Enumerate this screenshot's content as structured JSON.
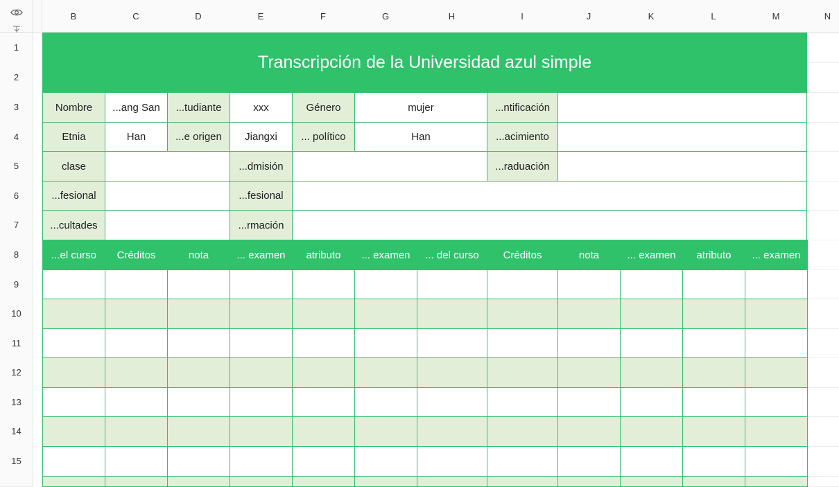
{
  "columns": [
    "B",
    "C",
    "D",
    "E",
    "F",
    "G",
    "H",
    "I",
    "J",
    "K",
    "L",
    "M",
    "N"
  ],
  "rows": [
    "1",
    "2",
    "3",
    "4",
    "5",
    "6",
    "7",
    "8",
    "9",
    "10",
    "11",
    "12",
    "13",
    "14",
    "15",
    ""
  ],
  "title": "Transcripción de la Universidad azul simple",
  "info": {
    "r3": {
      "b": "Nombre",
      "c": "...ang San",
      "d": "...tudiante",
      "e": "xxx",
      "f": "Género",
      "gh": "mujer",
      "i": "...ntificación",
      "jm": ""
    },
    "r4": {
      "b": "Etnia",
      "c": "Han",
      "d": "...e origen",
      "e": "Jiangxi",
      "f": "... político",
      "gh": "Han",
      "i": "...acimiento",
      "jm": ""
    },
    "r5": {
      "b": "clase",
      "cd": "",
      "e": "...dmisión",
      "fh": "",
      "i": "...raduación",
      "jm": ""
    },
    "r6": {
      "b": "...fesional",
      "cd": "",
      "e": "...fesional",
      "fm": ""
    },
    "r7": {
      "b": "...cultades",
      "cd": "",
      "e": "...rmación",
      "fm": ""
    }
  },
  "course_header": [
    "...el curso",
    "Créditos",
    "nota",
    "... examen",
    "atributo",
    "... examen",
    "... del curso",
    "Créditos",
    "nota",
    "... examen",
    "atributo",
    "... examen"
  ],
  "icons": {
    "visibility": "eye-icon",
    "freeze": "freeze-rows-icon"
  },
  "colors": {
    "accent": "#2fc26b",
    "label_fill": "#e3eed9"
  }
}
